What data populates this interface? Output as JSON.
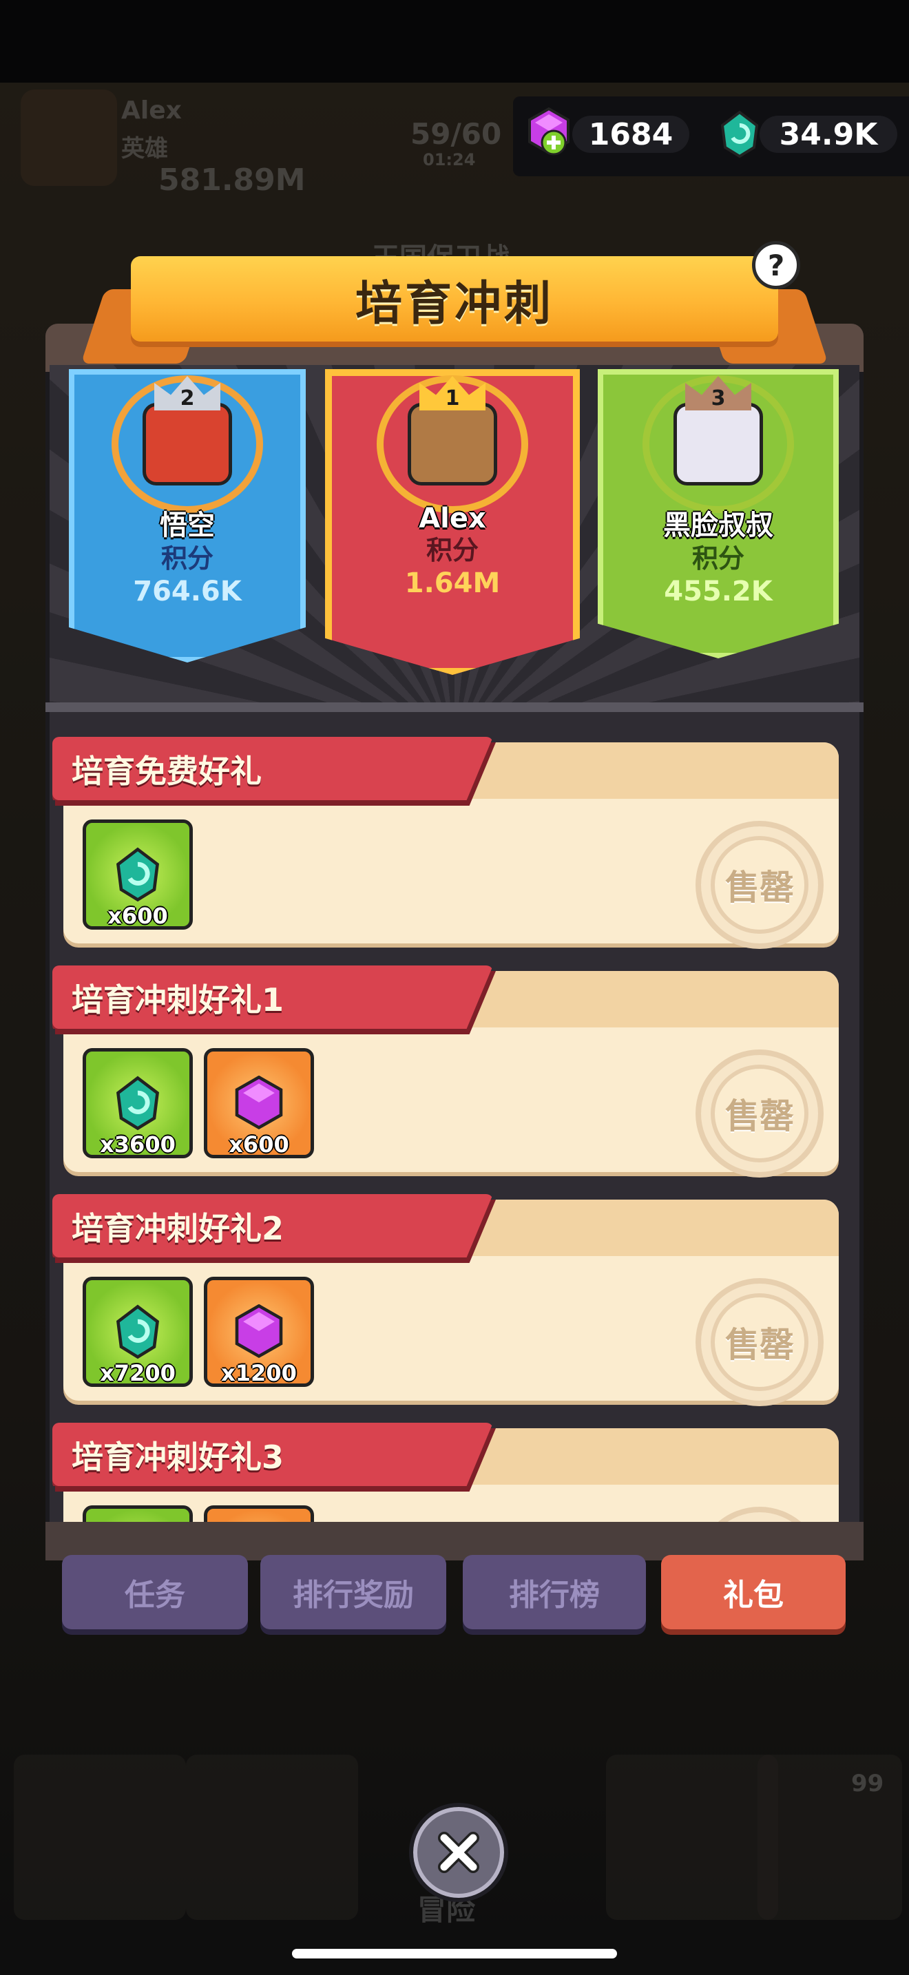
{
  "player": {
    "name": "Alex",
    "title": "英雄",
    "power": "581.89M"
  },
  "energy": {
    "value": "59/60",
    "timer": "01:24"
  },
  "currency": {
    "gems": "1684",
    "crystals": "34.9K"
  },
  "background_title": "王国保卫战",
  "dialog": {
    "title": "培育冲刺",
    "help_label": "?"
  },
  "podium": [
    {
      "rank": "2",
      "name": "悟空",
      "score_label": "积分",
      "score": "764.6K",
      "color": "#3a9ee0"
    },
    {
      "rank": "1",
      "name": "Alex",
      "score_label": "积分",
      "score": "1.64M",
      "color": "#d9434f"
    },
    {
      "rank": "3",
      "name": "黑脸叔叔",
      "score_label": "积分",
      "score": "455.2K",
      "color": "#8bc63a"
    }
  ],
  "gifts": [
    {
      "title": "培育免费好礼",
      "items": [
        {
          "type": "crystal",
          "qty": "x600"
        }
      ],
      "status": "售罄"
    },
    {
      "title": "培育冲刺好礼1",
      "items": [
        {
          "type": "crystal",
          "qty": "x3600"
        },
        {
          "type": "gem",
          "qty": "x600"
        }
      ],
      "status": "售罄"
    },
    {
      "title": "培育冲刺好礼2",
      "items": [
        {
          "type": "crystal",
          "qty": "x7200"
        },
        {
          "type": "gem",
          "qty": "x1200"
        }
      ],
      "status": "售罄"
    },
    {
      "title": "培育冲刺好礼3",
      "items": [
        {
          "type": "crystal",
          "qty": ""
        },
        {
          "type": "gem",
          "qty": ""
        }
      ],
      "status": ""
    }
  ],
  "tabs": [
    "任务",
    "排行奖励",
    "排行榜",
    "礼包"
  ],
  "active_tab": "礼包",
  "bottom_nav": {
    "center_label": "冒险",
    "badge_count": "99"
  },
  "icons": {
    "gem": "purple-gem-icon",
    "crystal": "teal-crystal-icon",
    "close": "close-icon"
  }
}
